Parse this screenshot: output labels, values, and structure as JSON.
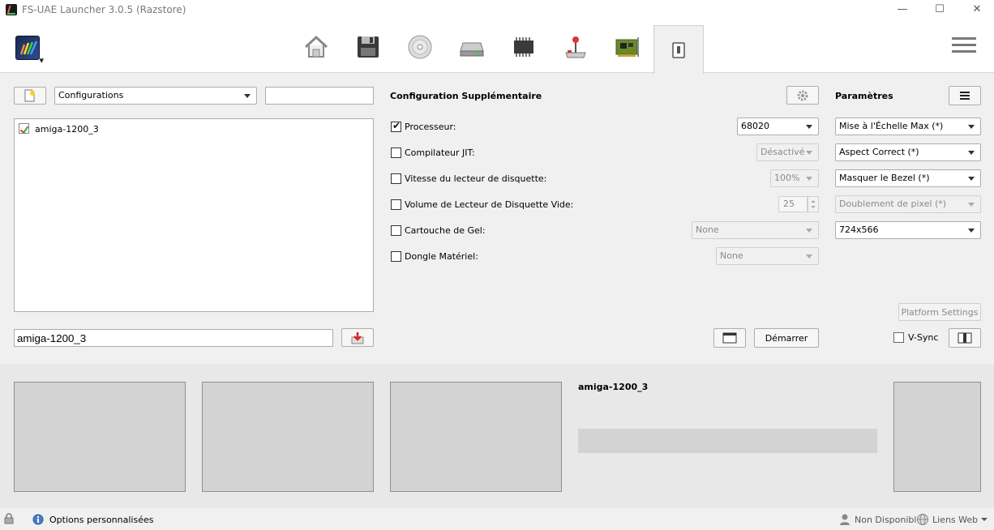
{
  "window": {
    "title": "FS-UAE Launcher 3.0.5 (Razstore)",
    "minimize": "—",
    "maximize": "☐",
    "close": "✕"
  },
  "toolbar": {
    "tools": [
      "home-icon",
      "floppy-icon",
      "cdrom-icon",
      "harddrive-icon",
      "memory-chip-icon",
      "joystick-icon",
      "expansion-card-icon"
    ],
    "selected_tab": "phone-icon",
    "menu": "hamburger-menu-icon"
  },
  "left": {
    "config_combo": "Configurations",
    "search_value": "",
    "list_items": [
      "amiga-1200_3"
    ],
    "name_value": "amiga-1200_3"
  },
  "middle": {
    "title": "Configuration Supplémentaire",
    "rows": [
      {
        "label": "Processeur:",
        "checked": true,
        "value": "68020",
        "disabled": false
      },
      {
        "label": "Compilateur JIT:",
        "checked": false,
        "value": "Désactivé",
        "disabled": true
      },
      {
        "label": "Vitesse du lecteur de disquette:",
        "checked": false,
        "value": "100%",
        "disabled": true
      },
      {
        "label": "Volume de Lecteur de Disquette Vide:",
        "checked": false,
        "value": "25",
        "disabled": true
      },
      {
        "label": "Cartouche de Gel:",
        "checked": false,
        "value": "None",
        "disabled": true
      },
      {
        "label": "Dongle Matériel:",
        "checked": false,
        "value": "None",
        "disabled": true
      }
    ],
    "start_label": "Démarrer"
  },
  "right": {
    "title": "Paramètres",
    "combos": [
      "Mise à l'Échelle Max (*)",
      "Aspect Correct (*)",
      "Masquer le Bezel (*)",
      "Doublement de pixel (*)",
      "724x566"
    ],
    "platform_settings": "Platform Settings",
    "vsync_label": "V-Sync"
  },
  "bottom": {
    "game_title": "amiga-1200_3"
  },
  "status": {
    "options_label": "Options personnalisées",
    "account_label": "Non Disponible",
    "links_label": "Liens Web"
  },
  "colors": {
    "window_bg": "#f0f0f0",
    "panel_bg": "#e8e8e8",
    "thumb_bg": "#d3d3d3"
  }
}
